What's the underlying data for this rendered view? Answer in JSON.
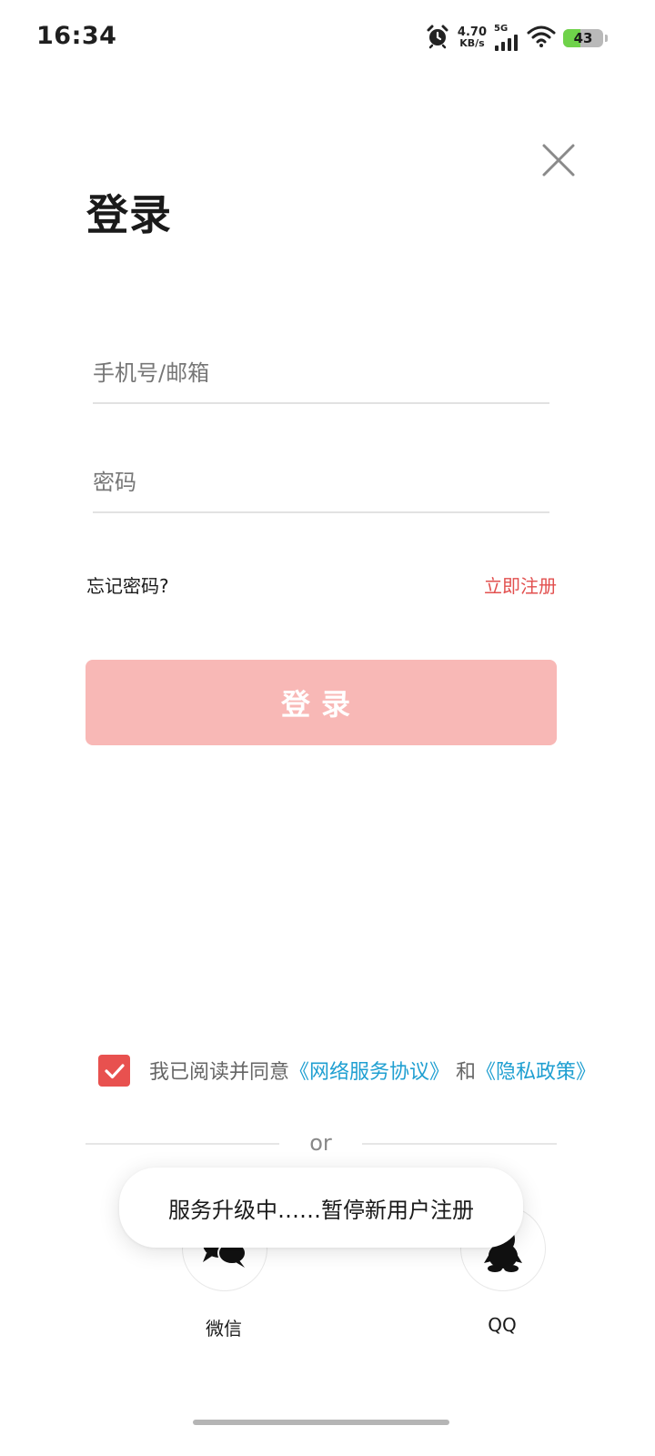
{
  "status_bar": {
    "time": "16:34",
    "net_speed_value": "4.70",
    "net_speed_unit": "KB/s",
    "network_type": "5G",
    "battery_level": "43",
    "battery_fraction": 0.43,
    "icons": [
      "alarm-icon",
      "signal-icon",
      "wifi-icon",
      "battery-icon"
    ]
  },
  "header": {
    "title": "登录",
    "close_icon": "close-icon"
  },
  "form": {
    "account_placeholder": "手机号/邮箱",
    "account_value": "",
    "password_placeholder": "密码",
    "password_value": "",
    "forgot_label": "忘记密码?",
    "register_label": "立即注册",
    "login_label": "登录"
  },
  "agreement": {
    "checked": true,
    "prefix": "我已阅读并同意",
    "service_link": "《网络服务协议》",
    "conjunction": " 和",
    "privacy_link": "《隐私政策》"
  },
  "divider": {
    "text": "or"
  },
  "social": {
    "wechat_label": "微信",
    "qq_label": "QQ"
  },
  "toast": {
    "message": "服务升级中……暂停新用户注册"
  },
  "colors": {
    "accent": "#e8514f",
    "login_button_disabled": "#f8b8b6",
    "link": "#1f9fd1",
    "register": "#e2504f"
  }
}
